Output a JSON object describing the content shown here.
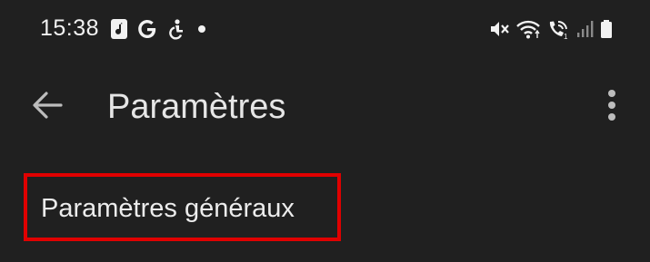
{
  "status_bar": {
    "time": "15:38",
    "notification_icons": [
      "music-note-icon",
      "google-g-icon",
      "accessibility-icon",
      "dot-icon"
    ],
    "system_icons": [
      "mute-vibrate-icon",
      "wifi-icon",
      "wifi-calling-icon",
      "signal-icon",
      "battery-icon"
    ]
  },
  "app_bar": {
    "title": "Paramètres",
    "back_icon": "arrow-back-icon",
    "more_icon": "more-vert-icon"
  },
  "list": {
    "items": [
      {
        "label": "Paramètres généraux"
      }
    ]
  },
  "colors": {
    "background": "#202020",
    "text": "#e6e6e6",
    "highlight": "#e00000"
  }
}
